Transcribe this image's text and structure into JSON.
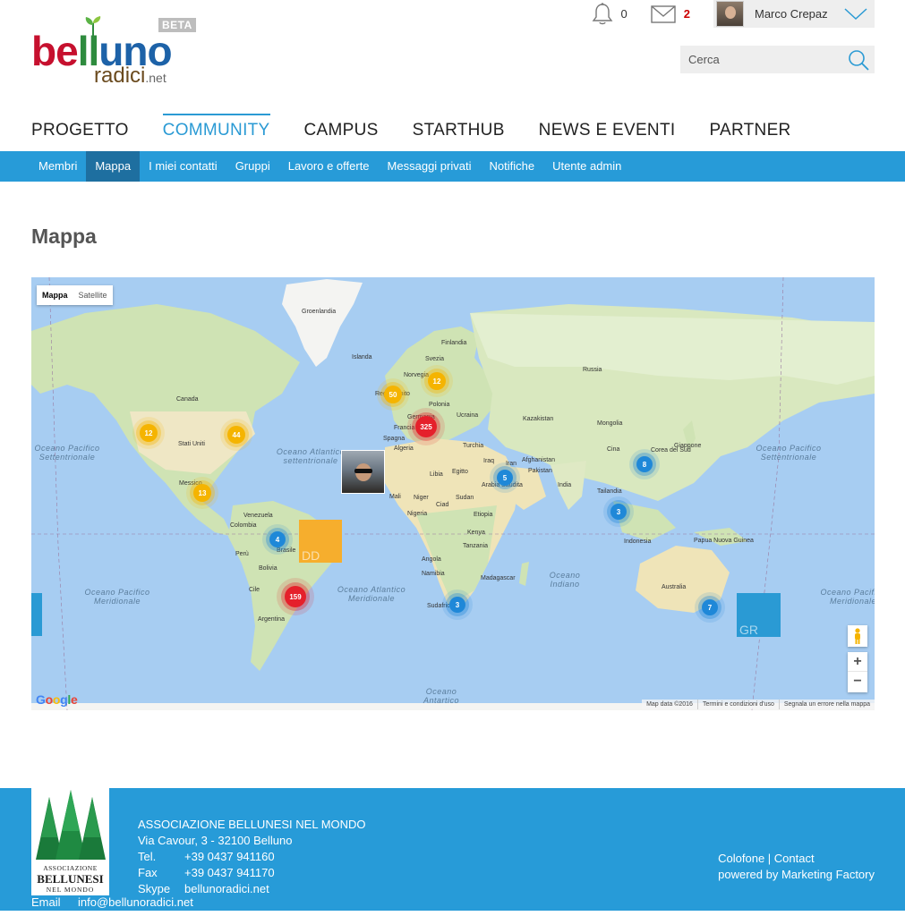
{
  "brand": {
    "line1_a": "be",
    "line1_b": "ll",
    "line1_c": "uno",
    "line2": "radici",
    "line2_suffix": ".net",
    "badge": "BETA"
  },
  "topbar": {
    "notifications_count": "0",
    "messages_count": "2",
    "user_name": "Marco Crepaz"
  },
  "search": {
    "placeholder": "Cerca"
  },
  "main_nav": [
    {
      "label": "PROGETTO",
      "active": false
    },
    {
      "label": "COMMUNITY",
      "active": true
    },
    {
      "label": "CAMPUS",
      "active": false
    },
    {
      "label": "STARTHUB",
      "active": false
    },
    {
      "label": "NEWS E EVENTI",
      "active": false
    },
    {
      "label": "PARTNER",
      "active": false
    }
  ],
  "sub_nav": [
    {
      "label": "Membri",
      "active": false
    },
    {
      "label": "Mappa",
      "active": true
    },
    {
      "label": "I miei contatti",
      "active": false
    },
    {
      "label": "Gruppi",
      "active": false
    },
    {
      "label": "Lavoro e offerte",
      "active": false
    },
    {
      "label": "Messaggi privati",
      "active": false
    },
    {
      "label": "Notifiche",
      "active": false
    },
    {
      "label": "Utente admin",
      "active": false
    }
  ],
  "page": {
    "title": "Mappa"
  },
  "map": {
    "type_buttons": {
      "map": "Mappa",
      "satellite": "Satellite"
    },
    "labels": {
      "groenlandia": "Groenlandia",
      "islanda": "Islanda",
      "finlandia": "Finlandia",
      "svezia": "Svezia",
      "norvegia": "Norvegia",
      "russia": "Russia",
      "canada": "Canada",
      "stati_uniti": "Stati Uniti",
      "messico": "Messico",
      "regno_unito": "Regno Unito",
      "polonia": "Polonia",
      "germania": "Germania",
      "ucraina": "Ucraina",
      "francia": "Francia",
      "spagna": "Spagna",
      "kazakistan": "Kazakistan",
      "mongolia": "Mongolia",
      "turchia": "Turchia",
      "cina": "Cina",
      "corea": "Corea del Sud",
      "giappone": "Giappone",
      "algeria": "Algeria",
      "libia": "Libia",
      "egitto": "Egitto",
      "iraq": "Iraq",
      "iran": "Iran",
      "afghanistan": "Afghanistan",
      "pakistan": "Pakistan",
      "india": "India",
      "arabia": "Arabia Saudita",
      "mali": "Mali",
      "niger": "Niger",
      "ciad": "Ciad",
      "sudan": "Sudan",
      "nigeria": "Nigeria",
      "etiopia": "Etiopia",
      "kenya": "Kenya",
      "tanzania": "Tanzania",
      "angola": "Angola",
      "namibia": "Namibia",
      "madagascar": "Madagascar",
      "sudafrica": "Sudafrica",
      "thailandia": "Tailandia",
      "indonesia": "Indonesia",
      "papua": "Papua Nuova Guinea",
      "australia": "Australia",
      "venezuela": "Venezuela",
      "colombia": "Colombia",
      "brasile": "Brasile",
      "peru": "Perù",
      "bolivia": "Bolivia",
      "cile": "Cile",
      "argentina": "Argentina"
    },
    "oceans": {
      "pac_nw": "Oceano Pacifico Settentrionale",
      "pac_ne": "Oceano Pacifico Settentrionale",
      "atl_n": "Oceano Atlantico settentrionale",
      "pac_sw": "Oceano Pacifico Meridionale",
      "pac_se": "Oceano Pacifico Meridionale",
      "atl_s": "Oceano Atlantico Meridionale",
      "indian": "Oceano Indiano",
      "antarctic": "Oceano Antartico"
    },
    "clusters": [
      {
        "name": "cluster-canada-west",
        "count": "12",
        "color": "yellow"
      },
      {
        "name": "cluster-usa-east",
        "count": "44",
        "color": "yellow"
      },
      {
        "name": "cluster-mexico",
        "count": "13",
        "color": "yellow"
      },
      {
        "name": "cluster-uk",
        "count": "50",
        "color": "yellow"
      },
      {
        "name": "cluster-scandinavia",
        "count": "12",
        "color": "yellow"
      },
      {
        "name": "cluster-europe",
        "count": "325",
        "color": "red"
      },
      {
        "name": "cluster-brazil",
        "count": "4",
        "color": "blue"
      },
      {
        "name": "cluster-argentina",
        "count": "159",
        "color": "red"
      },
      {
        "name": "cluster-middle-east",
        "count": "5",
        "color": "blue"
      },
      {
        "name": "cluster-south-africa",
        "count": "3",
        "color": "blue"
      },
      {
        "name": "cluster-china",
        "count": "8",
        "color": "blue"
      },
      {
        "name": "cluster-southeast-asia",
        "count": "3",
        "color": "blue"
      },
      {
        "name": "cluster-australia",
        "count": "7",
        "color": "blue"
      }
    ],
    "square_labels": {
      "orange": "DD",
      "blue": "GR"
    },
    "google_logo": "Google",
    "attribution": {
      "data": "Map data ©2016",
      "terms": "Termini e condizioni d'uso",
      "report": "Segnala un errore nella mappa"
    }
  },
  "footer": {
    "logo_line1": "ASSOCIAZIONE",
    "logo_line2": "BELLUNESI",
    "logo_line3": "NEL MONDO",
    "org": "ASSOCIAZIONE BELLUNESI NEL MONDO",
    "address": "Via Cavour, 3 - 32100 Belluno",
    "tel_label": "Tel.",
    "tel": "+39 0437 941160",
    "fax_label": "Fax",
    "fax": "+39 0437 941170",
    "skype_label": "Skype",
    "skype": "bellunoradici.net",
    "email_label": "Email",
    "email": "info@bellunoradici.net",
    "colofone": "Colofone",
    "sep": " | ",
    "contact": "Contact",
    "powered": "powered by Marketing Factory"
  }
}
